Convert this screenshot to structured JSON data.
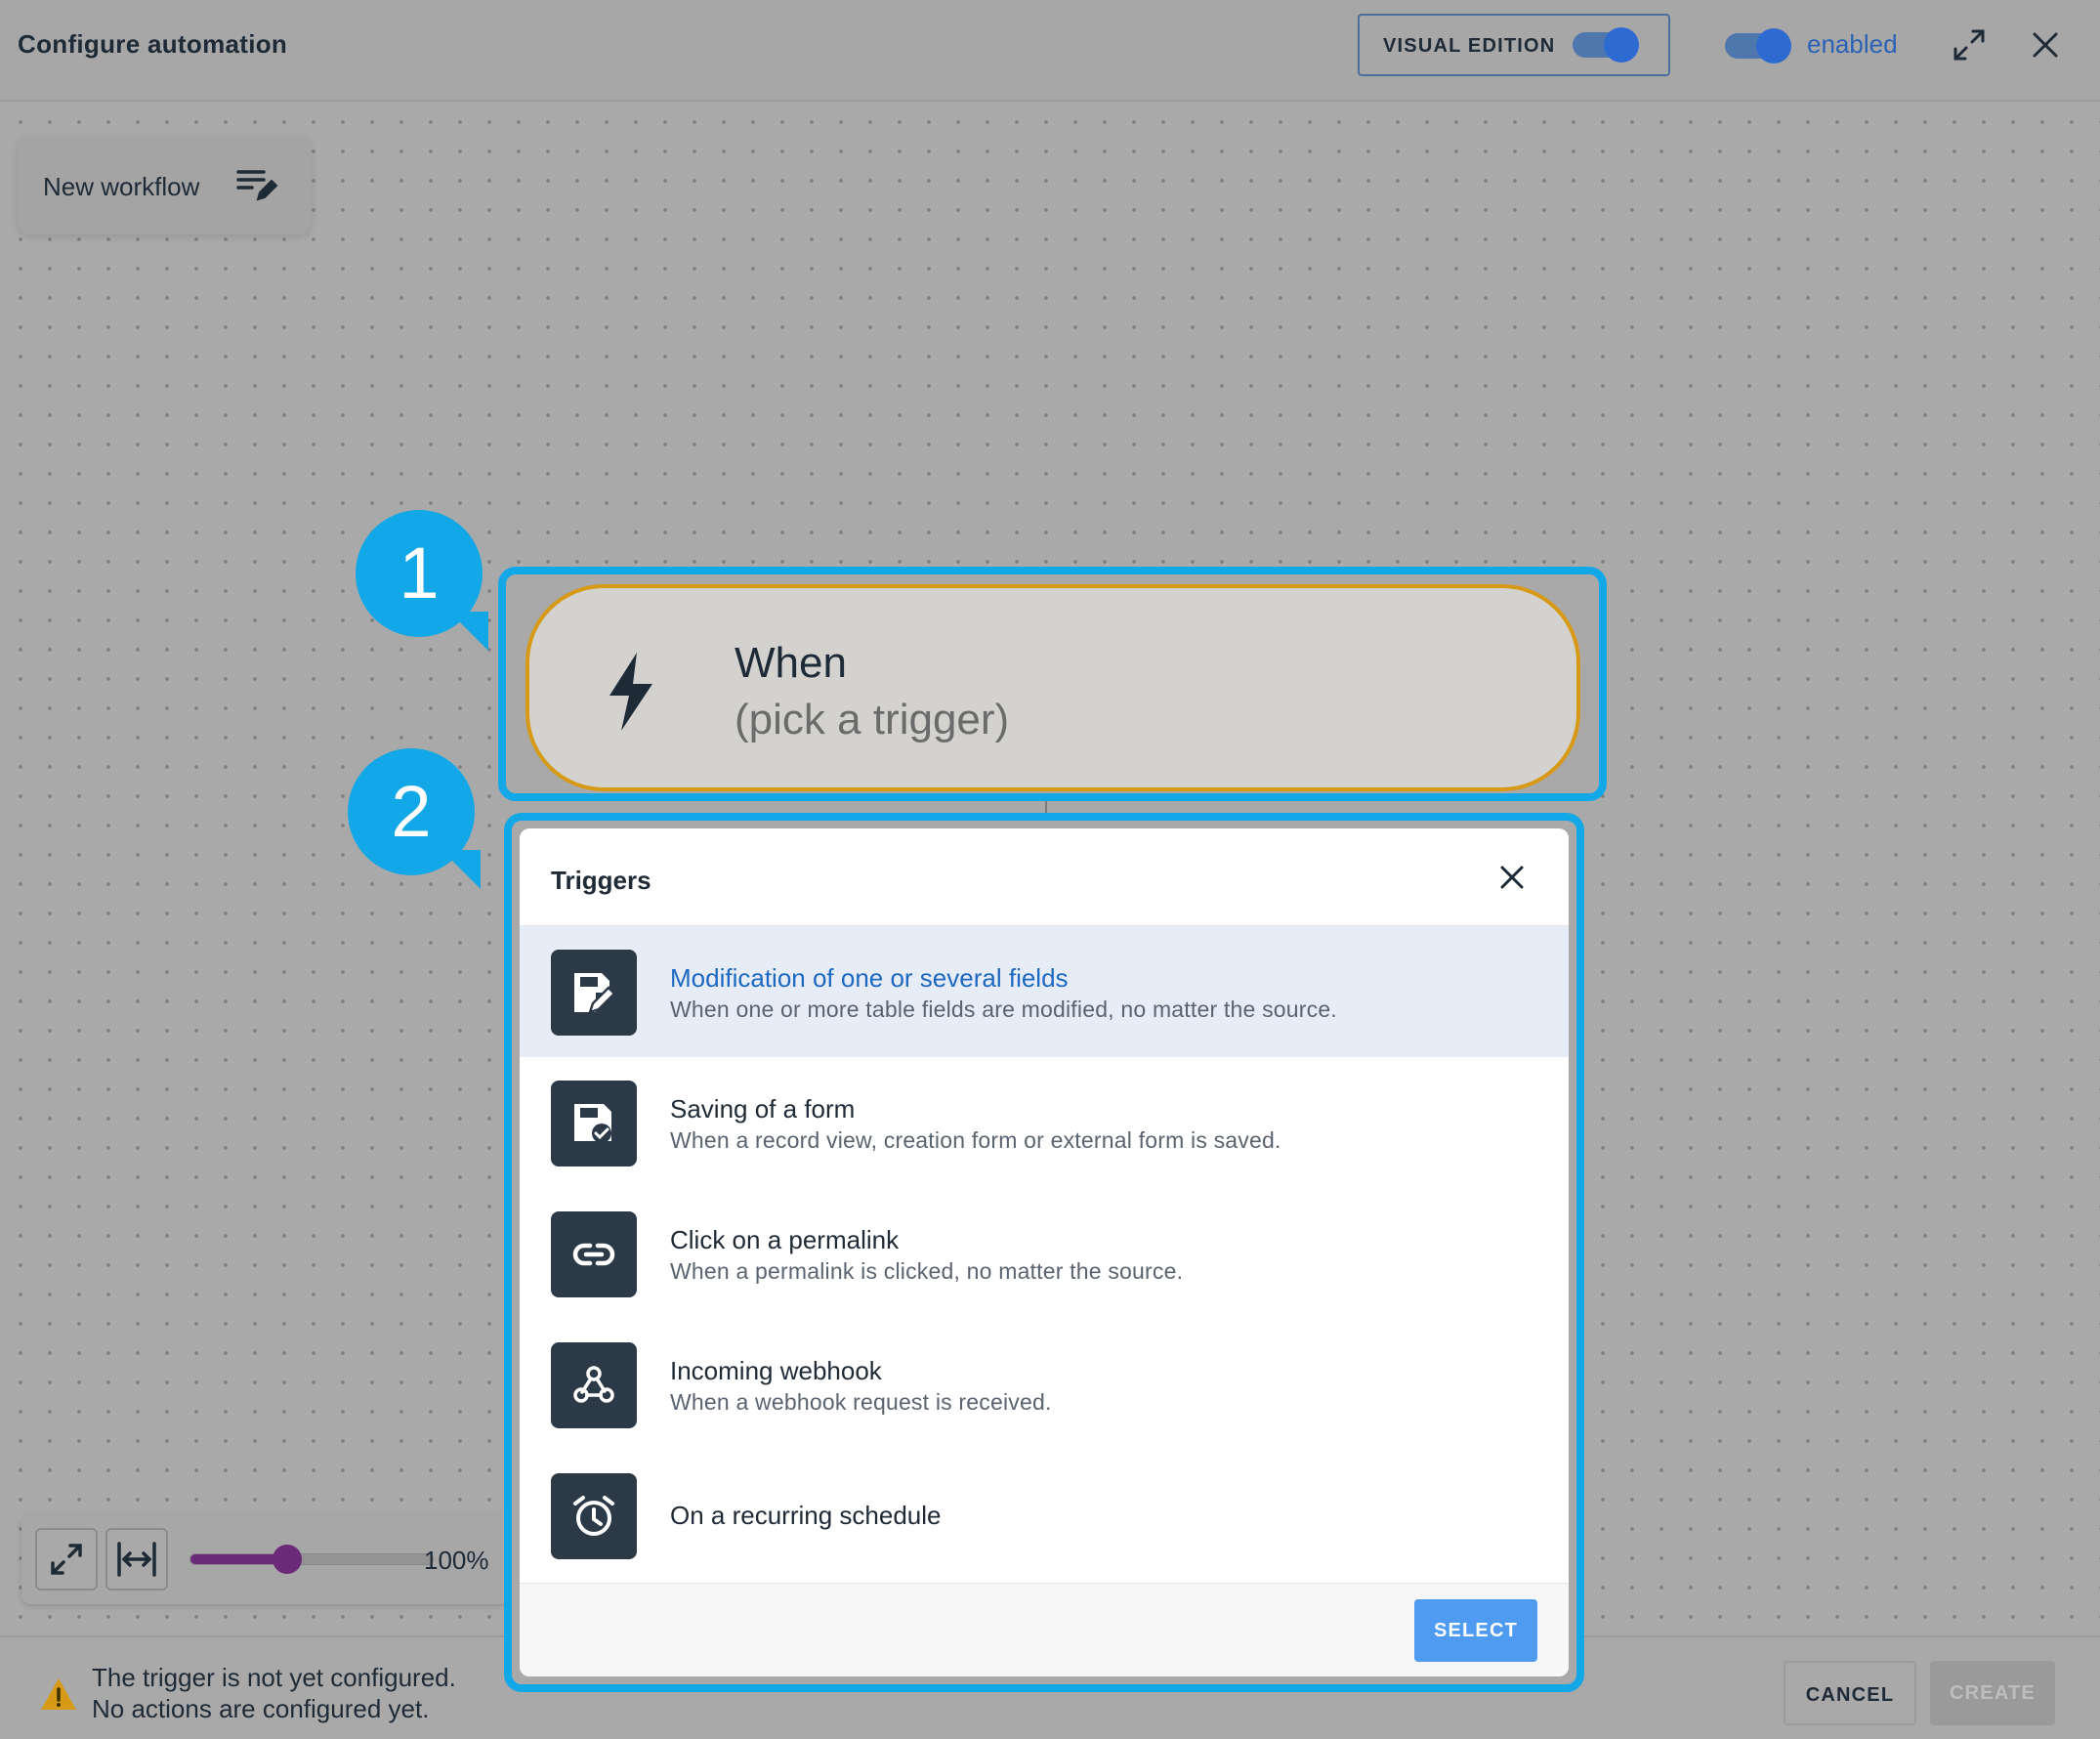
{
  "header": {
    "title": "Configure automation",
    "visual_edition_label": "VISUAL EDITION",
    "enabled_label": "enabled",
    "visual_edition_on": true,
    "enabled_on": true
  },
  "workflow": {
    "name": "New workflow"
  },
  "node": {
    "title": "When",
    "subtitle": "(pick a trigger)",
    "icon": "lightning-icon"
  },
  "annotations": {
    "bubble_1": "1",
    "bubble_2": "2"
  },
  "zoom": {
    "value_label": "100%",
    "slider_fraction": 0.4
  },
  "status": {
    "line1": "The trigger is not yet configured.",
    "line2": "No actions are configured yet."
  },
  "footer": {
    "cancel_label": "CANCEL",
    "create_label": "CREATE"
  },
  "modal": {
    "title": "Triggers",
    "select_label": "SELECT",
    "items": [
      {
        "label": "Modification of one or several fields",
        "description": "When one or more table fields are modified, no matter the source.",
        "icon": "edit-record-icon",
        "selected": true
      },
      {
        "label": "Saving of a form",
        "description": "When a record view, creation form or external form is saved.",
        "icon": "save-form-icon",
        "selected": false
      },
      {
        "label": "Click on a permalink",
        "description": "When a permalink is clicked, no matter the source.",
        "icon": "link-icon",
        "selected": false
      },
      {
        "label": "Incoming webhook",
        "description": "When a webhook request is received.",
        "icon": "webhook-icon",
        "selected": false
      },
      {
        "label": "On a recurring schedule",
        "description": "",
        "icon": "alarm-clock-icon",
        "selected": false
      }
    ]
  },
  "colors": {
    "accent": "#12a7e6",
    "node_border": "#d79a17",
    "selected_text": "#1e68c1",
    "select_button": "#4f9bf2",
    "slider": "#6b2a77"
  }
}
